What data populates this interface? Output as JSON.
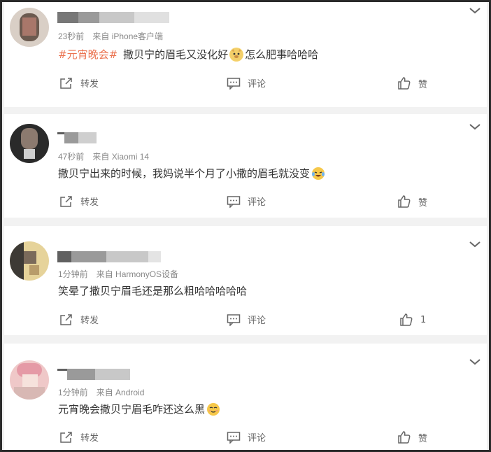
{
  "comments": [
    {
      "time": "23秒前",
      "source": "来自 iPhone客户端",
      "topic": "#元宵晚会#",
      "text_before": "撒贝宁的眉毛又没化好",
      "text_after": "怎么肥事哈哈哈",
      "emoji": "doge-emoji",
      "actions": {
        "repost": "转发",
        "comment": "评论",
        "like": "赞"
      }
    },
    {
      "time": "47秒前",
      "source": "来自 Xiaomi 14",
      "text_before": "撒贝宁出来的时候，我妈说半个月了小撒的眉毛就没变",
      "emoji": "laughing-tears-emoji",
      "actions": {
        "repost": "转发",
        "comment": "评论",
        "like": "赞"
      }
    },
    {
      "time": "1分钟前",
      "source": "来自 HarmonyOS设备",
      "text_before": "笑晕了撒贝宁眉毛还是那么粗哈哈哈哈哈",
      "actions": {
        "repost": "转发",
        "comment": "评论",
        "like": "1"
      }
    },
    {
      "time": "1分钟前",
      "source": "来自 Android",
      "text_before": "元宵晚会撒贝宁眉毛咋还这么黑",
      "emoji": "smirk-emoji",
      "actions": {
        "repost": "转发",
        "comment": "评论",
        "like": "赞"
      }
    }
  ],
  "colors": {
    "topic": "#eb7350",
    "meta": "#888888",
    "divider": "#f2f2f2"
  }
}
